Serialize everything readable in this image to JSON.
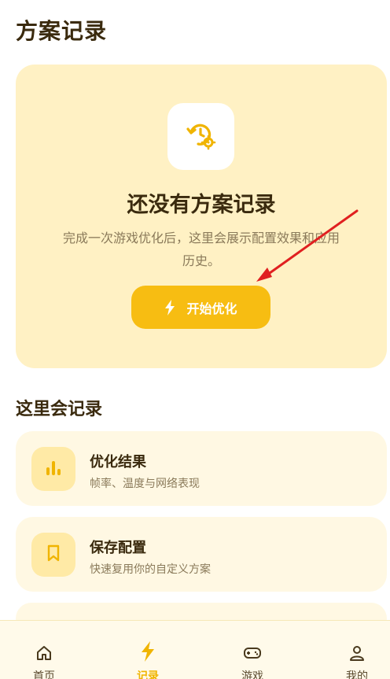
{
  "page": {
    "title": "方案记录"
  },
  "empty_state": {
    "icon": "history-settings-icon",
    "title": "还没有方案记录",
    "description_line1": "完成一次游戏优化后，这里会展示配置效果和应用",
    "description_line2": "历史。",
    "button_label": "开始优化"
  },
  "section": {
    "title": "这里会记录",
    "items": [
      {
        "icon": "bar-chart-icon",
        "title": "优化结果",
        "desc": "帧率、温度与网络表现"
      },
      {
        "icon": "bookmark-icon",
        "title": "保存配置",
        "desc": "快速复用你的自定义方案"
      }
    ]
  },
  "nav": {
    "items": [
      {
        "icon": "home-icon",
        "label": "首页"
      },
      {
        "icon": "bolt-icon",
        "label": "记录",
        "active": true
      },
      {
        "icon": "gamepad-icon",
        "label": "游戏"
      },
      {
        "icon": "user-icon",
        "label": "我的"
      }
    ]
  },
  "colors": {
    "accent": "#f7bd12",
    "card_bg": "#fff1c4",
    "feature_bg": "#fff8e3",
    "arrow": "#e02020"
  }
}
